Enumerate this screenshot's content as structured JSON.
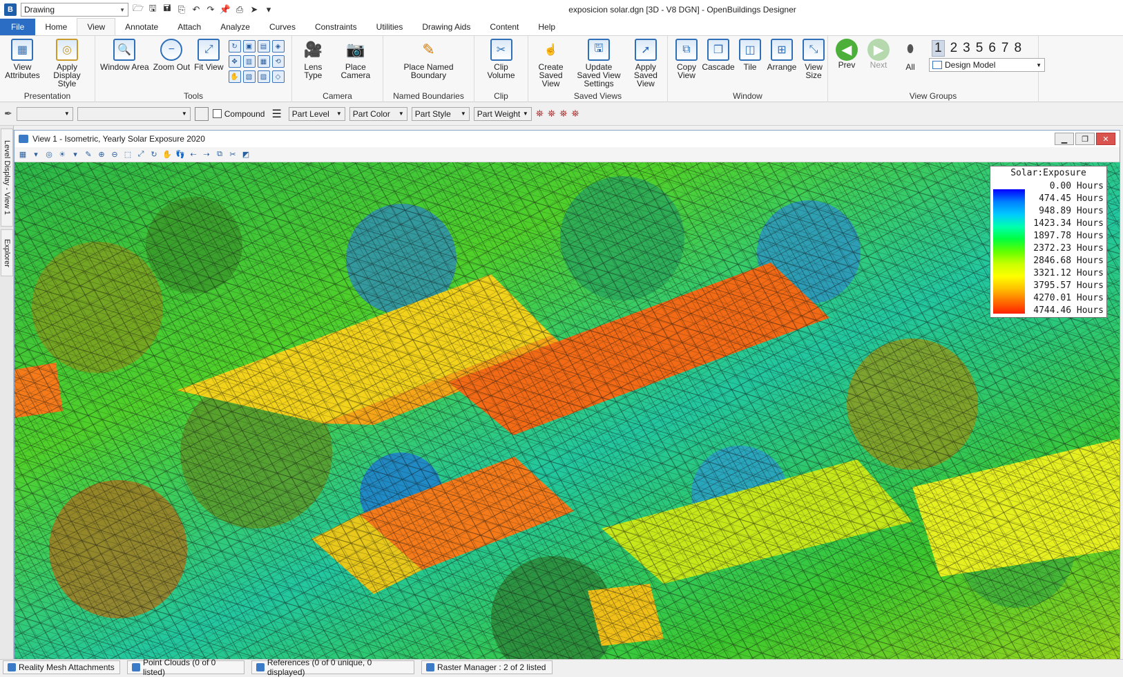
{
  "titlebar": {
    "workflow": "Drawing",
    "title": "exposicion solar.dgn [3D - V8 DGN] - OpenBuildings Designer"
  },
  "tabs": [
    "File",
    "Home",
    "View",
    "Annotate",
    "Attach",
    "Analyze",
    "Curves",
    "Constraints",
    "Utilities",
    "Drawing Aids",
    "Content",
    "Help"
  ],
  "active_tab": "View",
  "ribbon": {
    "presentation": {
      "label": "Presentation",
      "view_attributes": "View Attributes",
      "apply_display_style": "Apply Display Style"
    },
    "tools": {
      "label": "Tools",
      "window_area": "Window Area",
      "zoom_out": "Zoom Out",
      "fit_view": "Fit View"
    },
    "camera": {
      "label": "Camera",
      "lens_type": "Lens Type",
      "place_camera": "Place Camera"
    },
    "named_boundaries": {
      "label": "Named Boundaries",
      "place_named_boundary": "Place Named Boundary"
    },
    "clip": {
      "label": "Clip",
      "clip_volume": "Clip Volume"
    },
    "saved_views": {
      "label": "Saved Views",
      "create": "Create Saved View",
      "update": "Update Saved View Settings",
      "apply": "Apply Saved View"
    },
    "window": {
      "label": "Window",
      "copy_view": "Copy View",
      "cascade": "Cascade",
      "tile": "Tile",
      "arrange": "Arrange",
      "view_size": "View Size"
    },
    "view_groups": {
      "label": "View Groups",
      "prev": "Prev",
      "next": "Next",
      "all": "All",
      "numbers": [
        "1",
        "2",
        "3",
        "5",
        "6",
        "7",
        "8"
      ],
      "model": "Design Model"
    }
  },
  "attrbar": {
    "compound": "Compound",
    "part_level": "Part Level",
    "part_color": "Part Color",
    "part_style": "Part Style",
    "part_weight": "Part Weight"
  },
  "sidetabs": {
    "level_display": "Level Display - View 1",
    "explorer": "Explorer"
  },
  "view": {
    "title": "View 1 - Isometric, Yearly Solar Exposure 2020"
  },
  "legend": {
    "title": "Solar:Exposure",
    "values": [
      "0.00 Hours",
      "474.45 Hours",
      "948.89 Hours",
      "1423.34 Hours",
      "1897.78 Hours",
      "2372.23 Hours",
      "2846.68 Hours",
      "3321.12 Hours",
      "3795.57 Hours",
      "4270.01 Hours",
      "4744.46 Hours"
    ]
  },
  "statusbar": {
    "items": [
      "Reality Mesh Attachments",
      "Point Clouds (0 of 0 listed)",
      "References (0 of 0 unique, 0 displayed)",
      "Raster Manager : 2 of 2 listed"
    ]
  }
}
